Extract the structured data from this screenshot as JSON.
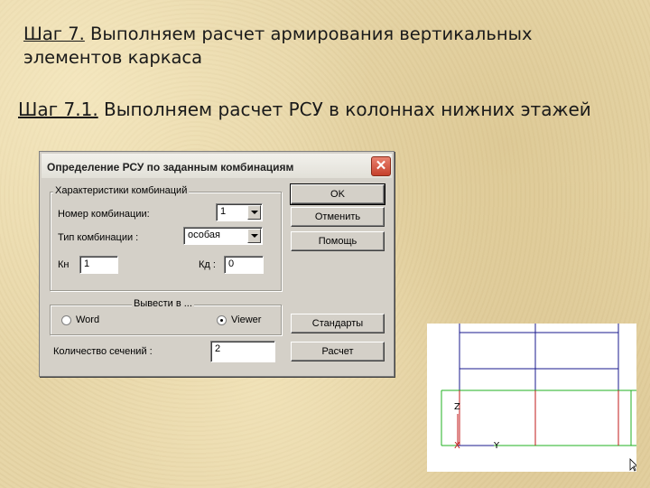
{
  "slide": {
    "step7_label": "Шаг 7.",
    "step7_text": " Выполняем расчет армирования вертикальных элементов каркаса",
    "step71_label": "Шаг 7.1.",
    "step71_text": " Выполняем расчет РСУ в колоннах нижних этажей"
  },
  "dialog": {
    "title": "Определение  РСУ по заданным комбинациям",
    "close_glyph": "✕",
    "group_characteristics": "Характеристики комбинаций",
    "combo_number_label": "Номер комбинации:",
    "combo_number_value": "1",
    "combo_type_label": "Тип комбинации :",
    "combo_type_value": "особая",
    "kn_label": "Кн",
    "kn_value": "1",
    "kd_label": "Кд :",
    "kd_value": "0",
    "group_output": "Вывести в ...",
    "radio_word": "Word",
    "radio_viewer": "Viewer",
    "selected_output": "Viewer",
    "sections_label": "Количество сечений :",
    "sections_value": "2",
    "buttons": {
      "ok": "OK",
      "cancel": "Отменить",
      "help": "Помощь",
      "standards": "Стандарты",
      "calculate": "Расчет"
    }
  },
  "viewer": {
    "axis_z": "Z",
    "axis_x": "X",
    "axis_y": "Y",
    "colors": {
      "frame": "#1a1a8c",
      "grid": "#20b020",
      "columns": "#c01818"
    }
  }
}
